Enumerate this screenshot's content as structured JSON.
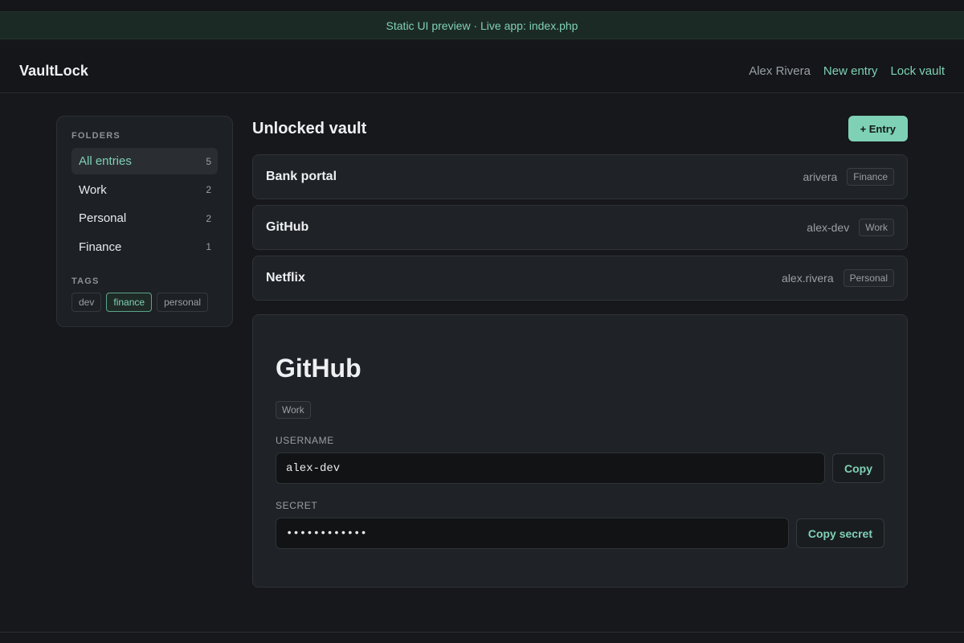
{
  "banner": {
    "text": "Static UI preview · Live app: index.php"
  },
  "header": {
    "brand": "VaultLock",
    "user": "Alex Rivera",
    "new_entry": "New entry",
    "lock_vault": "Lock vault"
  },
  "sidebar": {
    "folders_title": "FOLDERS",
    "folders": [
      {
        "label": "All entries",
        "count": "5"
      },
      {
        "label": "Work",
        "count": "2"
      },
      {
        "label": "Personal",
        "count": "2"
      },
      {
        "label": "Finance",
        "count": "1"
      }
    ],
    "tags_title": "TAGS",
    "tags": [
      "dev",
      "finance",
      "personal"
    ]
  },
  "main": {
    "title": "Unlocked vault",
    "add_button": "+ Entry",
    "entries": [
      {
        "name": "Bank portal",
        "username": "arivera",
        "folder": "Finance"
      },
      {
        "name": "GitHub",
        "username": "alex-dev",
        "folder": "Work"
      },
      {
        "name": "Netflix",
        "username": "alex.rivera",
        "folder": "Personal"
      }
    ]
  },
  "detail": {
    "title": "GitHub",
    "folder": "Work",
    "username_label": "USERNAME",
    "username_value": "alex-dev",
    "copy_label": "Copy",
    "secret_label": "SECRET",
    "secret_value": "••••••••••••",
    "copy_secret_label": "Copy secret"
  },
  "colors": {
    "accent": "#7fd1b5",
    "background": "#16181b",
    "card": "#1f2226"
  }
}
